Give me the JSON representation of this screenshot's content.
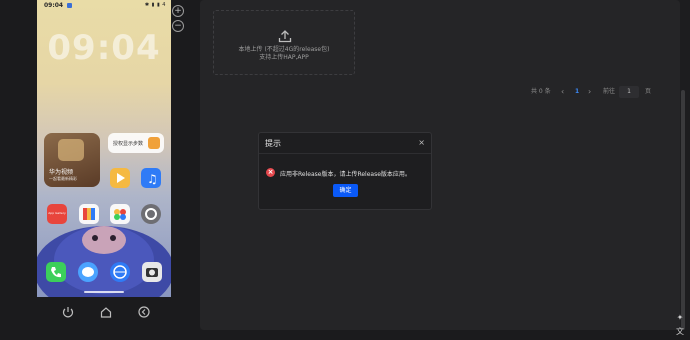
{
  "device": {
    "status_bar": {
      "time": "09:04",
      "right_indicators": "✱ ▮ ▮ 4"
    },
    "lock_clock": "09:04",
    "lock_date": "",
    "widgets": {
      "video_title": "华为视频",
      "video_subtitle": "一起看最新精彩",
      "steps_text": "授权显示步数"
    },
    "apps": [
      {
        "label": "",
        "color": "#f5b942"
      },
      {
        "label": "",
        "color": "#2f7bf6"
      },
      {
        "label": "App Gallery",
        "color": "#e8453c"
      },
      {
        "label": "",
        "color": "#ffffff"
      },
      {
        "label": "",
        "color": "#f8f8f8"
      },
      {
        "label": "",
        "color": "#6e6e73"
      }
    ],
    "dock": [
      {
        "name": "phone-app",
        "color": "#3ccf5b"
      },
      {
        "name": "messages-app",
        "color": "#4aa3ff"
      },
      {
        "name": "browser-app",
        "color": "#2f7bf6"
      },
      {
        "name": "camera-app",
        "color": "#e8e8e8"
      }
    ]
  },
  "upload": {
    "icon": "upload-icon",
    "line1": "本地上传 (不超过4G的release包)",
    "line2": "支持上传HAP,APP"
  },
  "pagination": {
    "total": "共 0 条",
    "prev": "‹",
    "current": "1",
    "next": "›",
    "goto_label": "前往",
    "goto_value": "1",
    "unit": "页"
  },
  "modal": {
    "title": "提示",
    "close": "×",
    "message": "应用非Release版本，请上传Release版本应用。",
    "ok_label": "确定",
    "error_color": "#e5484d",
    "accent_color": "#0a59f7"
  },
  "toolbar": {
    "zoom_in": "+",
    "zoom_out": "−"
  }
}
